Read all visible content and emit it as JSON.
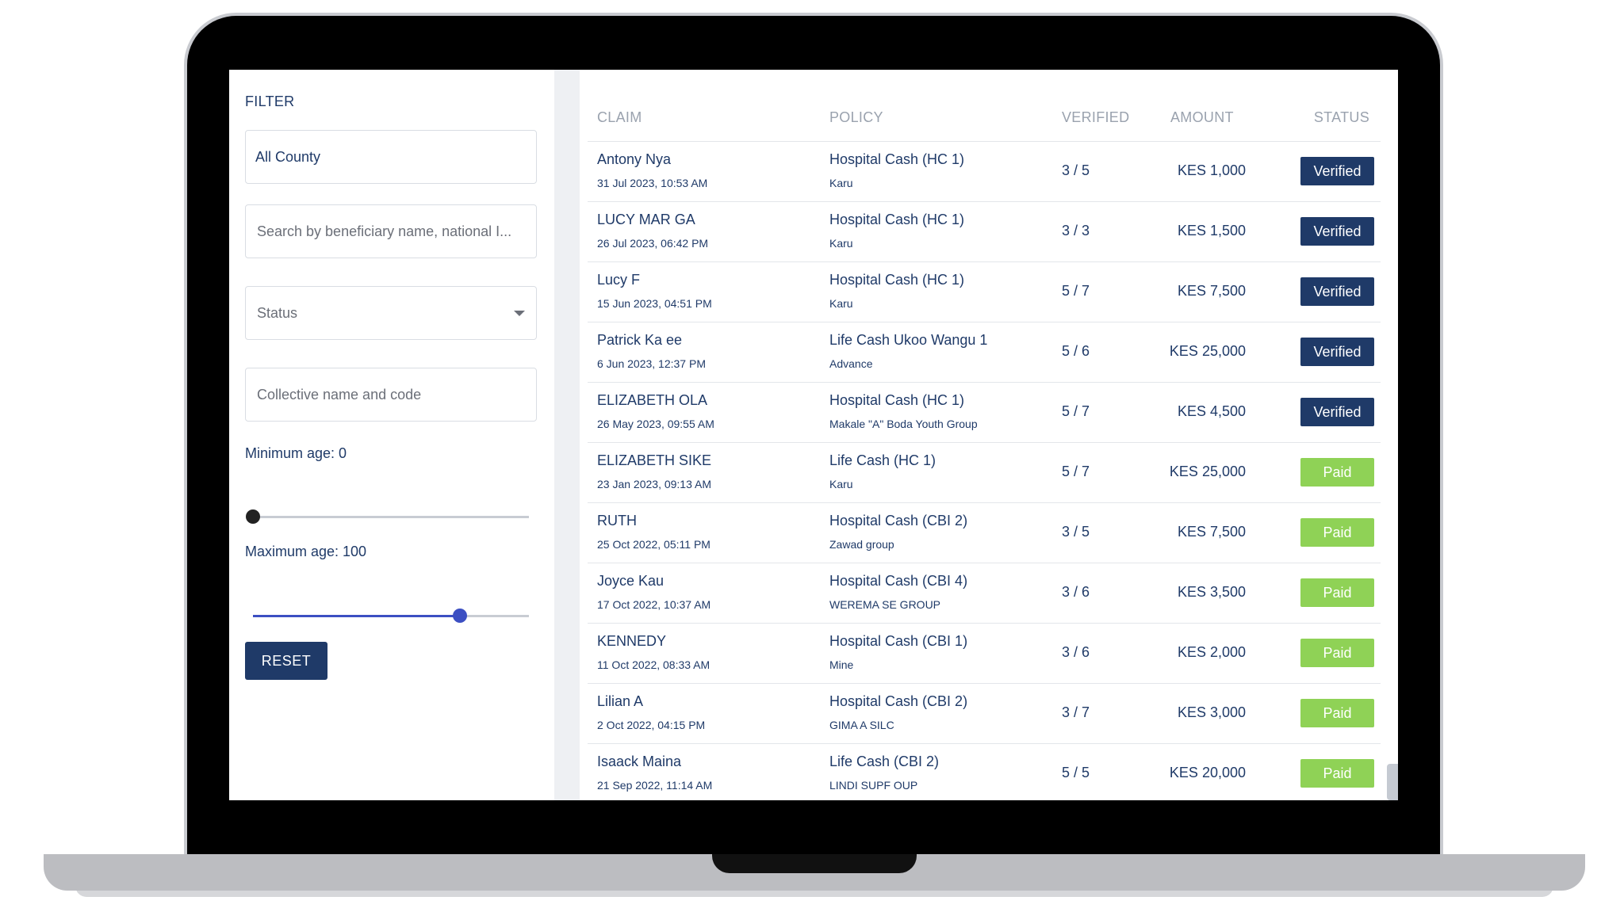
{
  "colors": {
    "primary": "#1f3a68",
    "verified_badge": "#1f3a68",
    "paid_badge": "#8fd256",
    "slider_accent": "#3c4fc2"
  },
  "filter": {
    "title": "FILTER",
    "county_value": "All County",
    "search_placeholder": "Search by beneficiary name, national I...",
    "status_placeholder": "Status",
    "collective_placeholder": "Collective name and code",
    "min_age_label": "Minimum age: 0",
    "max_age_label": "Maximum age: 100",
    "min_age_slider": {
      "value": 0,
      "max": 100
    },
    "max_age_slider": {
      "value": 75,
      "max": 100
    },
    "reset_label": "RESET"
  },
  "table": {
    "headers": {
      "claim": "CLAIM",
      "policy": "POLICY",
      "verified": "VERIFIED",
      "amount": "AMOUNT",
      "status": "STATUS"
    },
    "rows": [
      {
        "name": "Antony Nya",
        "date": "31 Jul 2023, 10:53 AM",
        "policy": "Hospital Cash (HC 1)",
        "group": "Karu",
        "verified": "3 / 5",
        "amount": "KES 1,000",
        "status": "Verified"
      },
      {
        "name": "LUCY MAR GA",
        "date": "26 Jul 2023, 06:42 PM",
        "policy": "Hospital Cash (HC 1)",
        "group": "Karu",
        "verified": "3 / 3",
        "amount": "KES 1,500",
        "status": "Verified"
      },
      {
        "name": "Lucy F",
        "date": "15 Jun 2023, 04:51 PM",
        "policy": "Hospital Cash (HC 1)",
        "group": "Karu",
        "verified": "5 / 7",
        "amount": "KES 7,500",
        "status": "Verified"
      },
      {
        "name": "Patrick Ka ee",
        "date": "6 Jun 2023, 12:37 PM",
        "policy": "Life Cash Ukoo Wangu 1",
        "group": "Advance",
        "verified": "5 / 6",
        "amount": "KES 25,000",
        "status": "Verified"
      },
      {
        "name": "ELIZABETH OLA",
        "date": "26 May 2023, 09:55 AM",
        "policy": "Hospital Cash (HC 1)",
        "group": "Makale \"A\" Boda Youth Group",
        "verified": "5 / 7",
        "amount": "KES 4,500",
        "status": "Verified"
      },
      {
        "name": "ELIZABETH SIKE",
        "date": "23 Jan 2023, 09:13 AM",
        "policy": "Life Cash (HC 1)",
        "group": "Karu",
        "verified": "5 / 7",
        "amount": "KES 25,000",
        "status": "Paid"
      },
      {
        "name": "RUTH",
        "date": "25 Oct 2022, 05:11 PM",
        "policy": "Hospital Cash (CBI 2)",
        "group": "Zawad group",
        "verified": "3 / 5",
        "amount": "KES 7,500",
        "status": "Paid"
      },
      {
        "name": "Joyce Kau",
        "date": "17 Oct 2022, 10:37 AM",
        "policy": "Hospital Cash (CBI 4)",
        "group": "WEREMA SE GROUP",
        "verified": "3 / 6",
        "amount": "KES 3,500",
        "status": "Paid"
      },
      {
        "name": "KENNEDY",
        "date": "11 Oct 2022, 08:33 AM",
        "policy": "Hospital Cash (CBI 1)",
        "group": "Mine",
        "verified": "3 / 6",
        "amount": "KES 2,000",
        "status": "Paid"
      },
      {
        "name": "Lilian A",
        "date": "2 Oct 2022, 04:15 PM",
        "policy": "Hospital Cash (CBI 2)",
        "group": "GIMA A SILC",
        "verified": "3 / 7",
        "amount": "KES 3,000",
        "status": "Paid"
      },
      {
        "name": "Isaack Maina",
        "date": "21 Sep 2022, 11:14 AM",
        "policy": "Life Cash (CBI 2)",
        "group": "LINDI SUPF OUP",
        "verified": "5 / 5",
        "amount": "KES 20,000",
        "status": "Paid"
      }
    ]
  }
}
